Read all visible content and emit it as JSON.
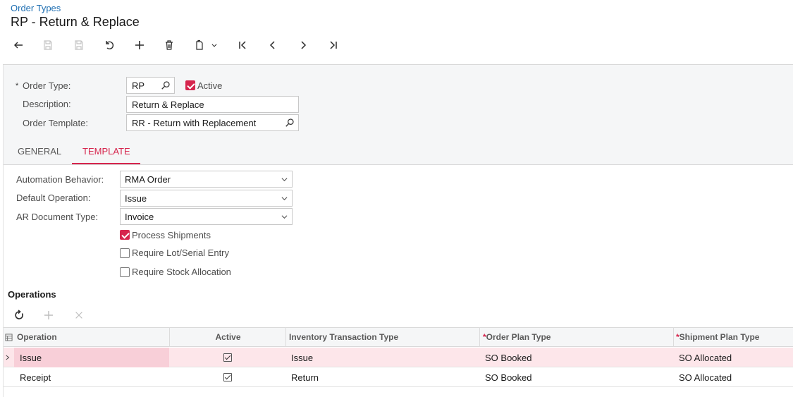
{
  "breadcrumb": "Order Types",
  "title": "RP - Return & Replace",
  "toolbar": {
    "icons": [
      "back-icon",
      "save-close-icon",
      "save-icon",
      "undo-icon",
      "add-icon",
      "delete-icon",
      "copy-paste-icon",
      "first-icon",
      "previous-icon",
      "next-icon",
      "last-icon"
    ]
  },
  "header": {
    "required_mark": "*",
    "order_type_label": "Order Type:",
    "order_type_value": "RP",
    "active_label": "Active",
    "active_checked": true,
    "description_label": "Description:",
    "description_value": "Return & Replace",
    "template_label": "Order Template:",
    "template_value": "RR - Return with Replacement"
  },
  "tabs": [
    {
      "label": "GENERAL",
      "active": false
    },
    {
      "label": "TEMPLATE",
      "active": true
    }
  ],
  "template": {
    "automation_label": "Automation Behavior:",
    "automation_value": "RMA Order",
    "default_op_label": "Default Operation:",
    "default_op_value": "Issue",
    "ar_doc_label": "AR Document Type:",
    "ar_doc_value": "Invoice",
    "process_shipments_label": "Process Shipments",
    "process_shipments_checked": true,
    "require_lot_label": "Require Lot/Serial Entry",
    "require_lot_checked": false,
    "require_stock_label": "Require Stock Allocation",
    "require_stock_checked": false
  },
  "operations": {
    "title": "Operations",
    "columns": {
      "operation": "Operation",
      "active": "Active",
      "inv_tran_type": "Inventory Transaction Type",
      "order_plan_type": "Order Plan Type",
      "shipment_plan_type": "Shipment Plan Type",
      "required_mark": "*"
    },
    "rows": [
      {
        "operation": "Issue",
        "active": true,
        "inv_tran_type": "Issue",
        "order_plan_type": "SO Booked",
        "shipment_plan_type": "SO Allocated",
        "selected": true
      },
      {
        "operation": "Receipt",
        "active": true,
        "inv_tran_type": "Return",
        "order_plan_type": "SO Booked",
        "shipment_plan_type": "SO Allocated",
        "selected": false
      }
    ]
  },
  "colors": {
    "accent": "#d6254d",
    "link": "#1f6fb2",
    "selected_row": "#fde6ea"
  }
}
